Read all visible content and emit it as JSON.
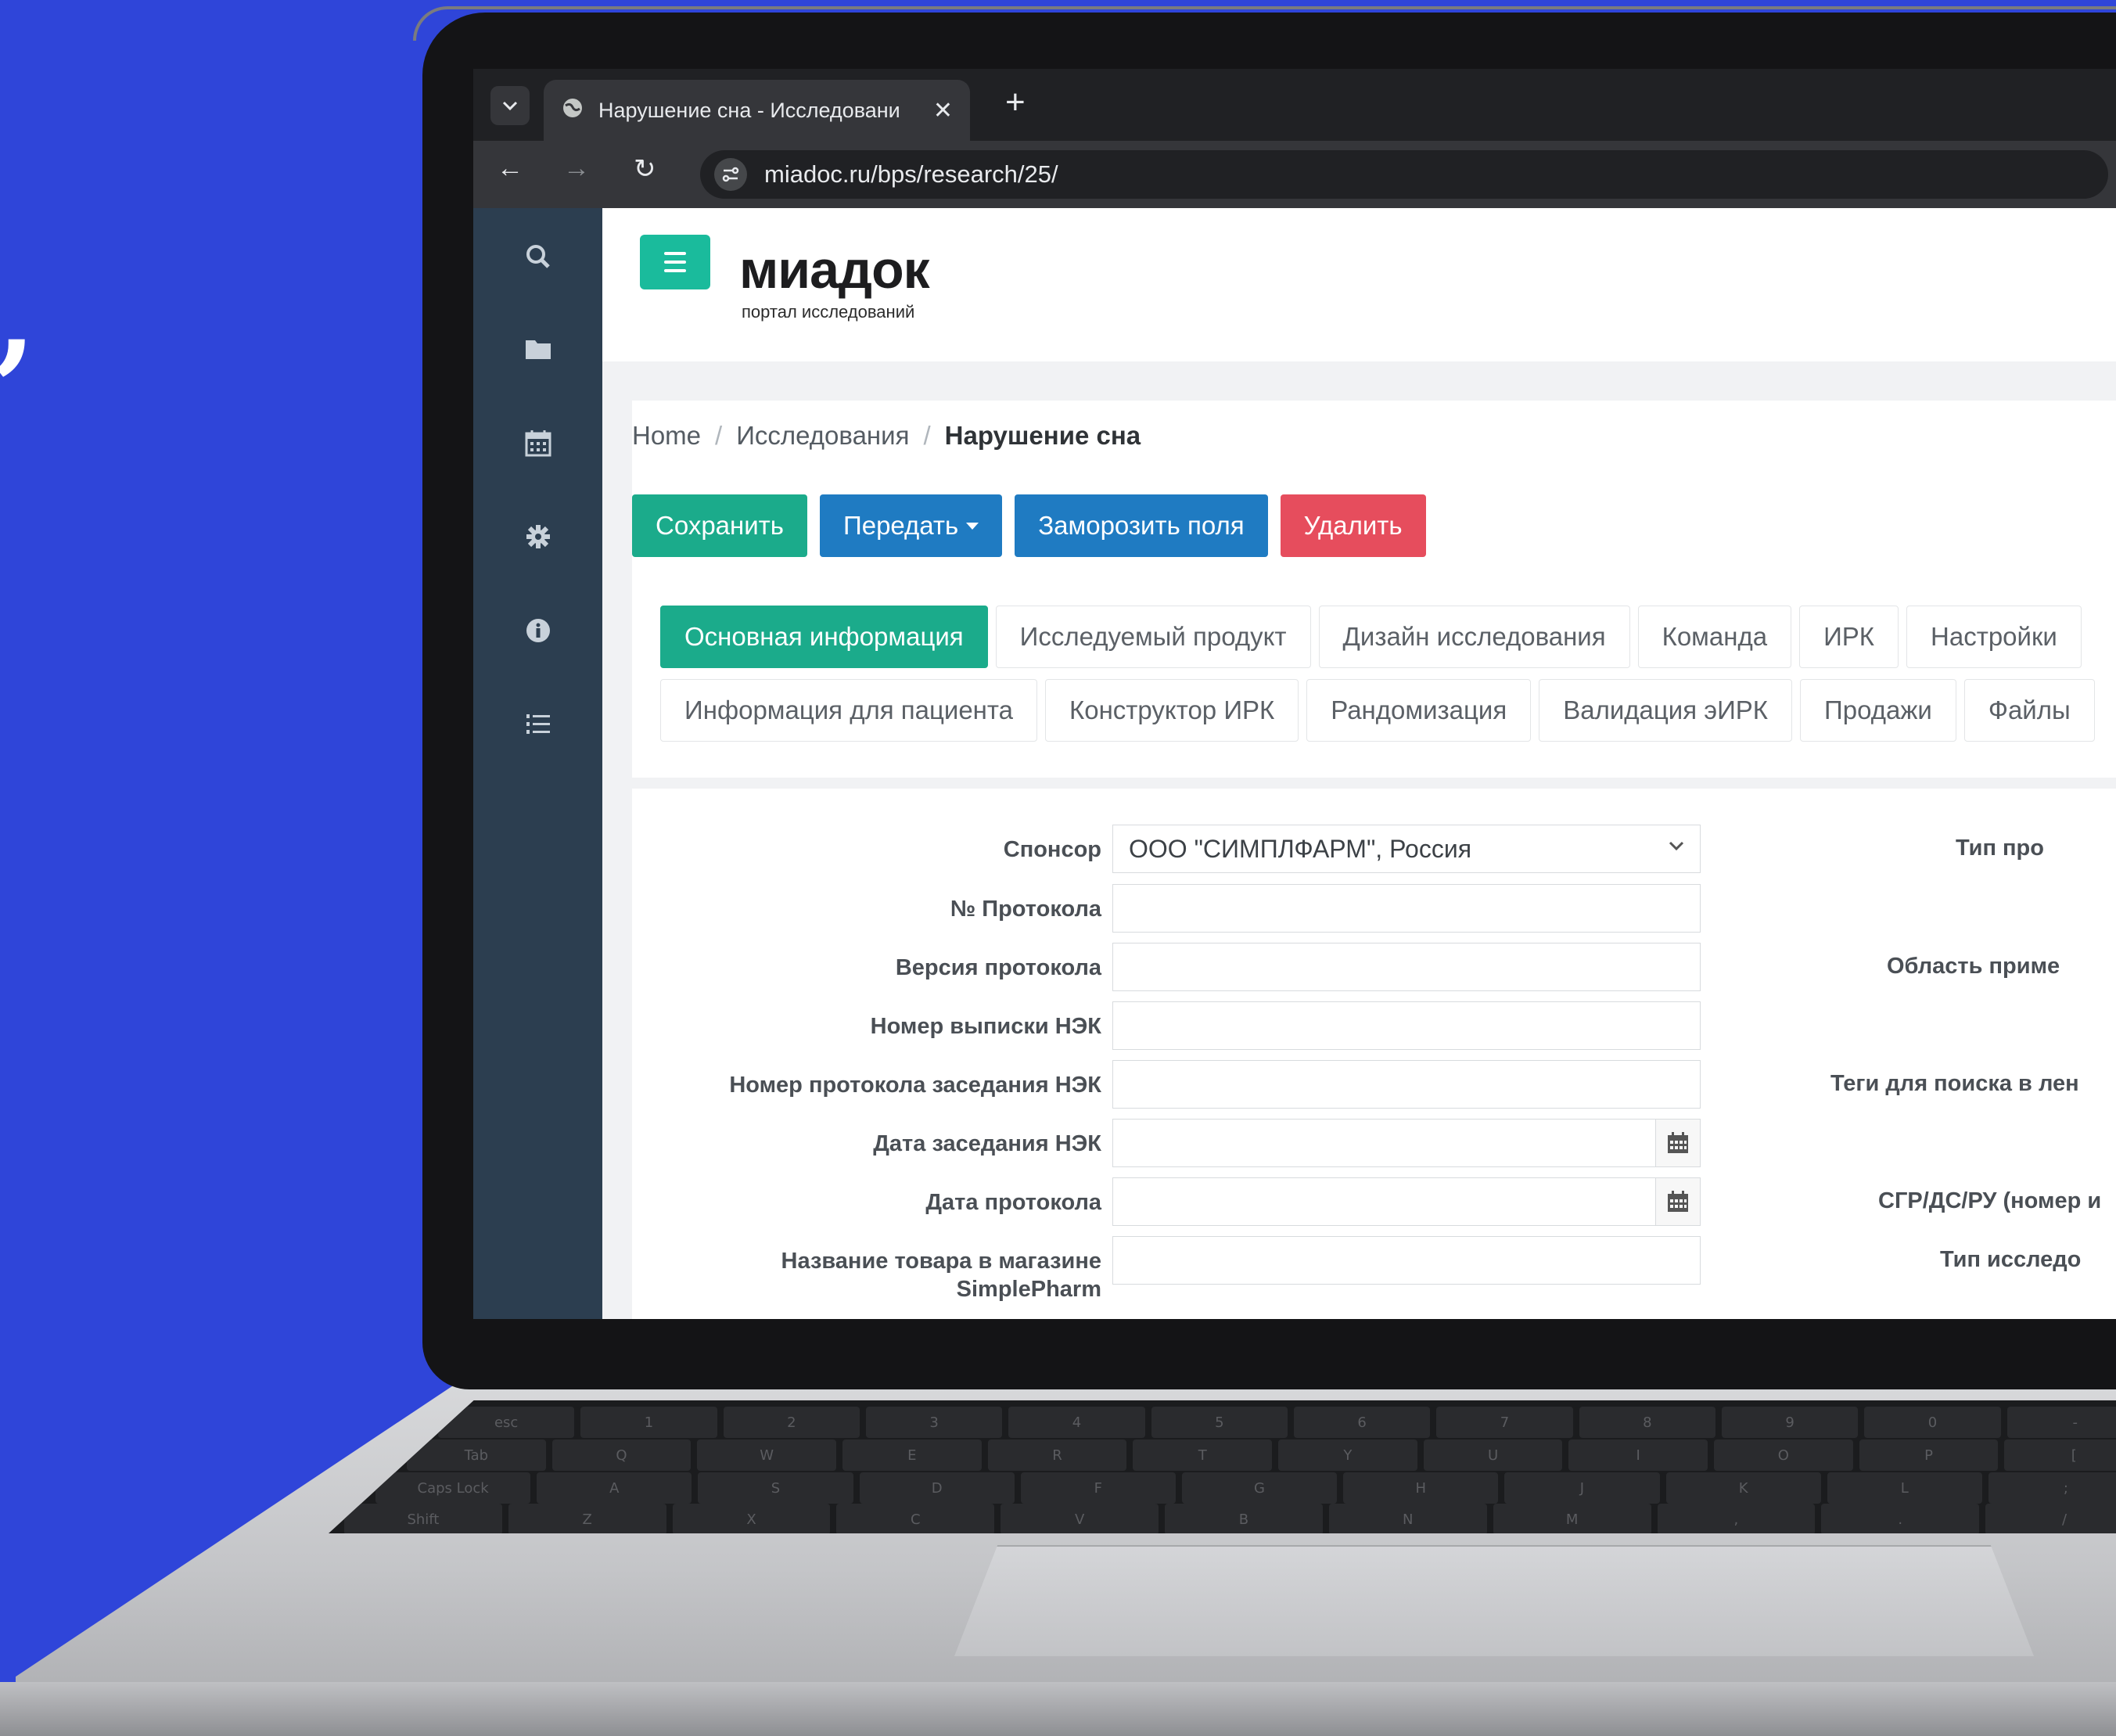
{
  "browser": {
    "tab_title": "Нарушение сна - Исследовани",
    "tab_close": "✕",
    "new_tab": "+",
    "url": "miadoc.ru/bps/research/25/"
  },
  "logo": {
    "text": "миадок",
    "subtitle": "портал исследований"
  },
  "sidebar": {
    "icons": [
      "search-icon",
      "folder-icon",
      "calendar-icon",
      "gear-icon",
      "info-icon",
      "list-icon"
    ]
  },
  "breadcrumb": {
    "home": "Home",
    "section": "Исследования",
    "current": "Нарушение сна",
    "separator": "/"
  },
  "actions": {
    "save": "Сохранить",
    "transfer": "Передать",
    "freeze": "Заморозить поля",
    "delete": "Удалить"
  },
  "tabs_row1": [
    "Основная информация",
    "Исследуемый продукт",
    "Дизайн исследования",
    "Команда",
    "ИРК",
    "Настройки"
  ],
  "tabs_row2": [
    "Информация для пациента",
    "Конструктор ИРК",
    "Рандомизация",
    "Валидация эИРК",
    "Продажи",
    "Файлы"
  ],
  "form_left": {
    "sponsor_label": "Спонсор",
    "sponsor_value": "ООО \"СИМПЛФАРМ\", Россия",
    "protocol_no_label": "№ Протокола",
    "protocol_version_label": "Версия протокола",
    "nek_extract_label": "Номер выписки НЭК",
    "nek_protocol_label": "Номер протокола заседания НЭК",
    "nek_date_label": "Дата заседания НЭК",
    "protocol_date_label": "Дата протокола",
    "shop_name_label_1": "Название товара в магазине",
    "shop_name_label_2": "SimplePharm"
  },
  "form_right": {
    "type_label": "Тип про",
    "dot": "•",
    "area_label": "Область приме",
    "tags_label": "Теги для поиска в лен",
    "sgr_label": "СГР/ДС/РУ (номер и",
    "study_type_label": "Тип исследо"
  },
  "colors": {
    "accent_green": "#1bab8b",
    "primary_blue": "#1f7bc2",
    "danger_red": "#e64d5d",
    "sidebar": "#2c3e50",
    "background": "#2f45d9"
  }
}
